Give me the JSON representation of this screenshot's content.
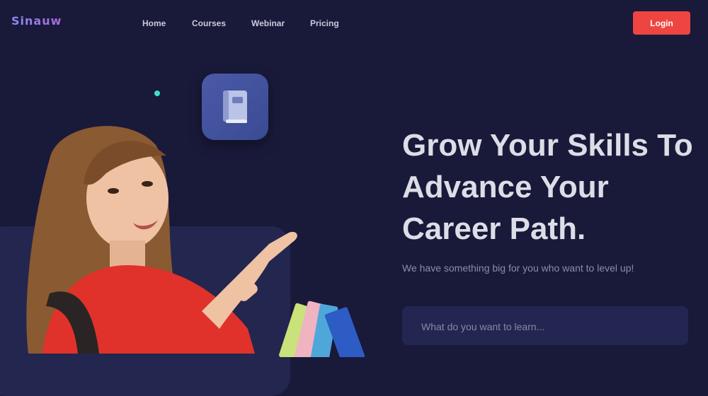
{
  "brand": {
    "name": "Sinauw"
  },
  "nav": {
    "items": [
      {
        "label": "Home"
      },
      {
        "label": "Courses"
      },
      {
        "label": "Webinar"
      },
      {
        "label": "Pricing"
      }
    ]
  },
  "header": {
    "login_label": "Login"
  },
  "hero": {
    "title_lines": [
      "Grow Your Skills To",
      "Advance Your",
      "Career Path."
    ],
    "subtitle": "We have something big for you who want to level up!",
    "search_placeholder": "What do you want to learn..."
  },
  "colors": {
    "background": "#19193a",
    "accent": "#ef4541",
    "panel": "#23264e",
    "dot": "#3ee0c4",
    "book_tile": "#4050a0"
  },
  "icons": {
    "book_tile": "book-icon",
    "decorative_dot": "dot"
  }
}
